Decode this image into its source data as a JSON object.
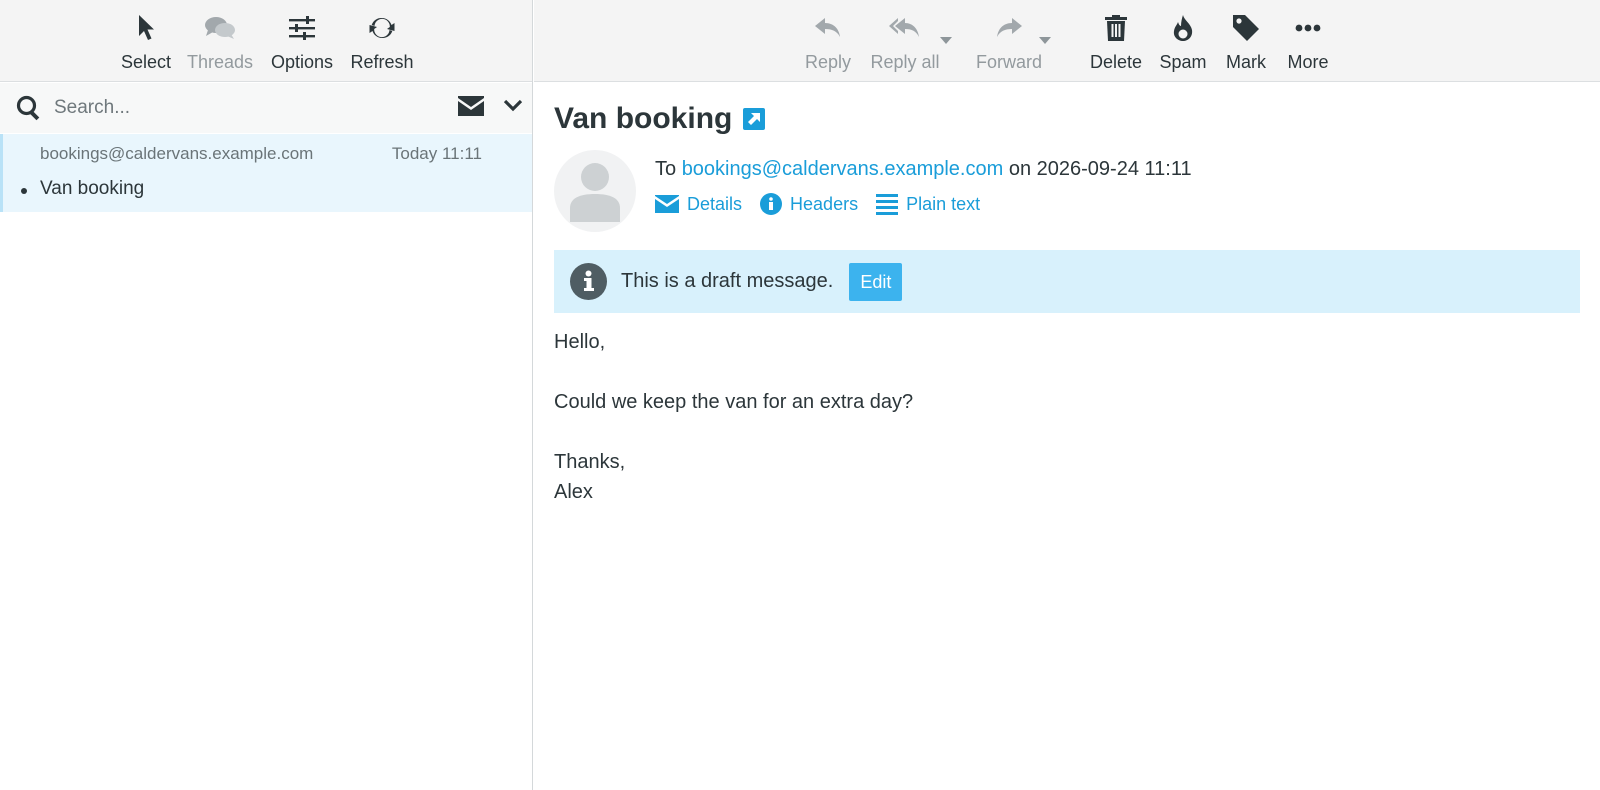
{
  "left_toolbar": {
    "select": "Select",
    "threads": "Threads",
    "options": "Options",
    "refresh": "Refresh"
  },
  "search": {
    "placeholder": "Search..."
  },
  "message_list": [
    {
      "from": "bookings@caldervans.example.com",
      "date": "Today 11:11",
      "subject": "Van booking"
    }
  ],
  "right_toolbar": {
    "reply": "Reply",
    "reply_all": "Reply all",
    "forward": "Forward",
    "delete": "Delete",
    "spam": "Spam",
    "mark": "Mark",
    "more": "More"
  },
  "message": {
    "title": "Van booking",
    "to_prefix": "To",
    "to_address": "bookings@caldervans.example.com",
    "on_word": "on",
    "date": "2026-09-24 11:11",
    "links": {
      "details": "Details",
      "headers": "Headers",
      "plain_text": "Plain text"
    },
    "draft_notice": "This is a draft message.",
    "edit_label": "Edit",
    "body": {
      "greeting": "Hello,",
      "line1": "Could we keep the van for an extra day?",
      "signoff": "Thanks,",
      "name": "Alex"
    }
  },
  "colors": {
    "link": "#1a9dd9",
    "selected_row": "#e9f6fd",
    "draft_box": "#d8f1fc",
    "edit_button": "#3cb3ee"
  }
}
